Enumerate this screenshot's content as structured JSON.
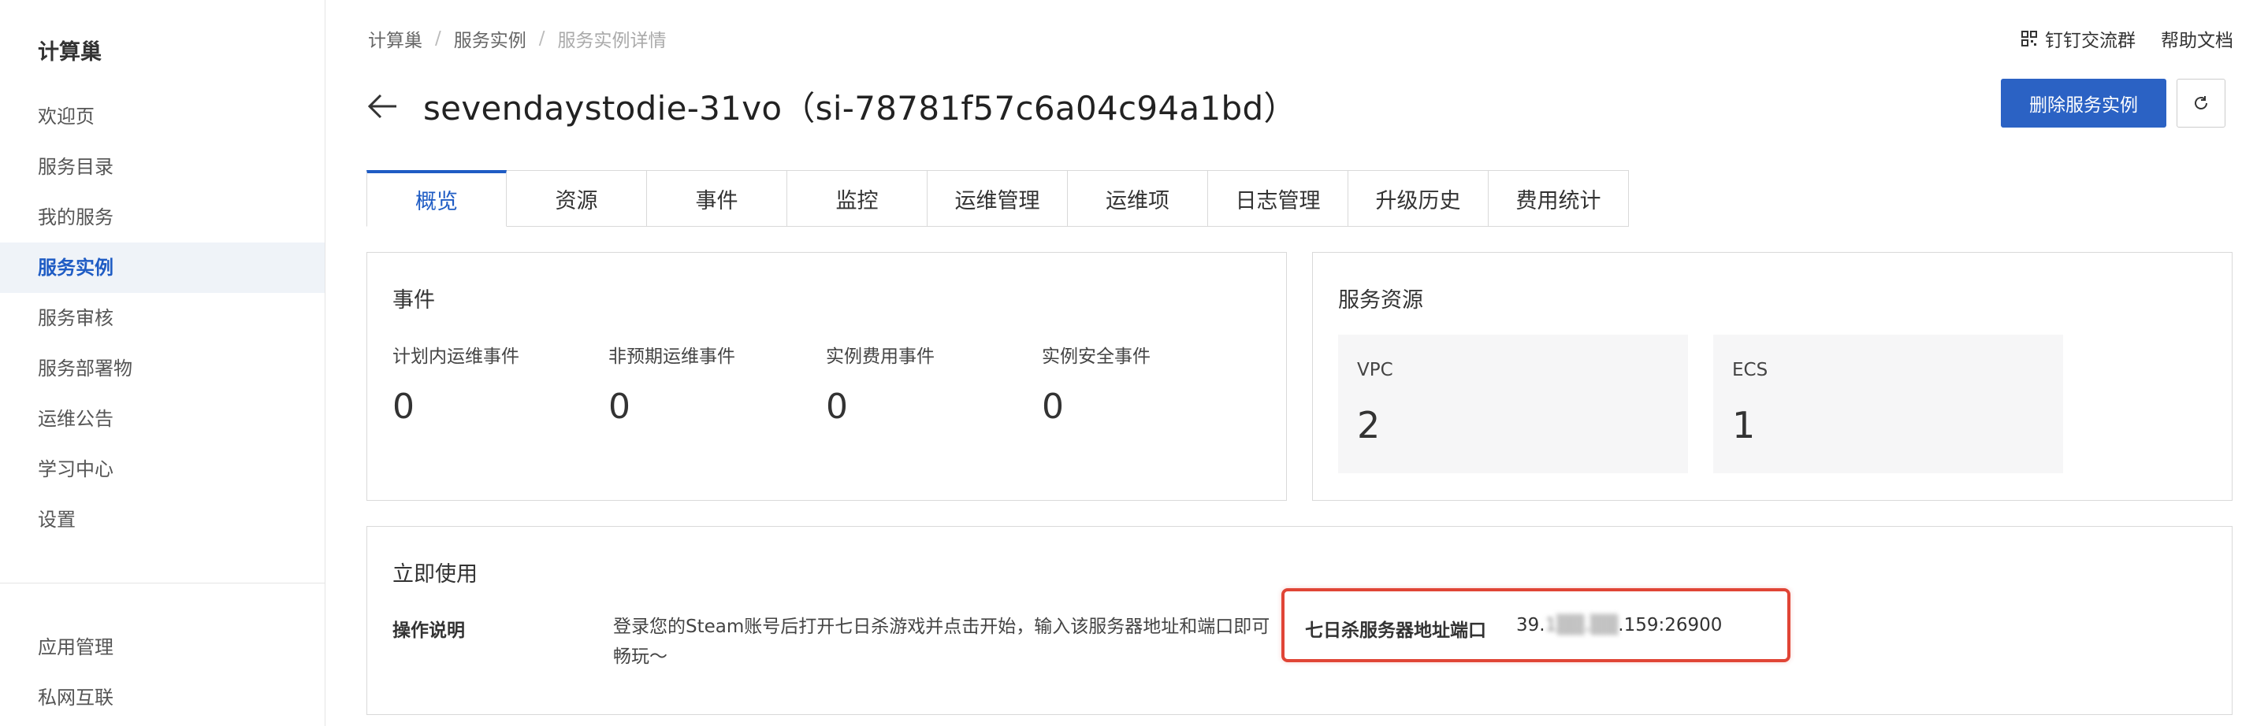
{
  "sidebar": {
    "title": "计算巢",
    "items": [
      {
        "label": "欢迎页",
        "active": false
      },
      {
        "label": "服务目录",
        "active": false
      },
      {
        "label": "我的服务",
        "active": false
      },
      {
        "label": "服务实例",
        "active": true
      },
      {
        "label": "服务审核",
        "active": false
      },
      {
        "label": "服务部署物",
        "active": false
      },
      {
        "label": "运维公告",
        "active": false
      },
      {
        "label": "学习中心",
        "active": false
      },
      {
        "label": "设置",
        "active": false
      }
    ],
    "bottom_items": [
      {
        "label": "应用管理"
      },
      {
        "label": "私网互联"
      }
    ]
  },
  "breadcrumb": [
    "计算巢",
    "服务实例",
    "服务实例详情"
  ],
  "header_links": {
    "dingtalk": "钉钉交流群",
    "help": "帮助文档"
  },
  "page_title": "sevendaystodie-31vo（si-78781f57c6a04c94a1bd）",
  "delete_button": "删除服务实例",
  "tabs": [
    "概览",
    "资源",
    "事件",
    "监控",
    "运维管理",
    "运维项",
    "日志管理",
    "升级历史",
    "费用统计"
  ],
  "active_tab": "概览",
  "events_card": {
    "title": "事件",
    "items": [
      {
        "label": "计划内运维事件",
        "value": "0"
      },
      {
        "label": "非预期运维事件",
        "value": "0"
      },
      {
        "label": "实例费用事件",
        "value": "0"
      },
      {
        "label": "实例安全事件",
        "value": "0"
      }
    ]
  },
  "resources_card": {
    "title": "服务资源",
    "items": [
      {
        "label": "VPC",
        "value": "2"
      },
      {
        "label": "ECS",
        "value": "1"
      }
    ]
  },
  "use_card": {
    "title": "立即使用",
    "op_label": "操作说明",
    "op_desc": "登录您的Steam账号后打开七日杀游戏并点击开始，输入该服务器地址和端口即可畅玩～",
    "addr_label": "七日杀服务器地址端口",
    "addr_prefix": "39.",
    "addr_masked": "1▒▒.▒▒",
    "addr_suffix": ".159:26900"
  },
  "colors": {
    "accent": "#1f5cc4",
    "primary_button": "#2b62c4",
    "highlight": "#e04536"
  }
}
